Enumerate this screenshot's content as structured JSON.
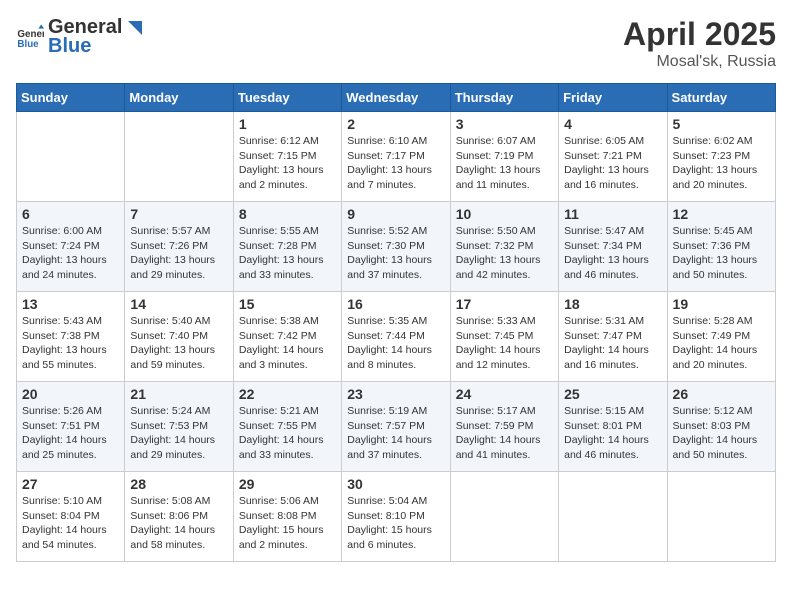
{
  "header": {
    "logo_general": "General",
    "logo_blue": "Blue",
    "month": "April 2025",
    "location": "Mosal'sk, Russia"
  },
  "columns": [
    "Sunday",
    "Monday",
    "Tuesday",
    "Wednesday",
    "Thursday",
    "Friday",
    "Saturday"
  ],
  "weeks": [
    [
      {
        "day": "",
        "info": ""
      },
      {
        "day": "",
        "info": ""
      },
      {
        "day": "1",
        "info": "Sunrise: 6:12 AM\nSunset: 7:15 PM\nDaylight: 13 hours\nand 2 minutes."
      },
      {
        "day": "2",
        "info": "Sunrise: 6:10 AM\nSunset: 7:17 PM\nDaylight: 13 hours\nand 7 minutes."
      },
      {
        "day": "3",
        "info": "Sunrise: 6:07 AM\nSunset: 7:19 PM\nDaylight: 13 hours\nand 11 minutes."
      },
      {
        "day": "4",
        "info": "Sunrise: 6:05 AM\nSunset: 7:21 PM\nDaylight: 13 hours\nand 16 minutes."
      },
      {
        "day": "5",
        "info": "Sunrise: 6:02 AM\nSunset: 7:23 PM\nDaylight: 13 hours\nand 20 minutes."
      }
    ],
    [
      {
        "day": "6",
        "info": "Sunrise: 6:00 AM\nSunset: 7:24 PM\nDaylight: 13 hours\nand 24 minutes."
      },
      {
        "day": "7",
        "info": "Sunrise: 5:57 AM\nSunset: 7:26 PM\nDaylight: 13 hours\nand 29 minutes."
      },
      {
        "day": "8",
        "info": "Sunrise: 5:55 AM\nSunset: 7:28 PM\nDaylight: 13 hours\nand 33 minutes."
      },
      {
        "day": "9",
        "info": "Sunrise: 5:52 AM\nSunset: 7:30 PM\nDaylight: 13 hours\nand 37 minutes."
      },
      {
        "day": "10",
        "info": "Sunrise: 5:50 AM\nSunset: 7:32 PM\nDaylight: 13 hours\nand 42 minutes."
      },
      {
        "day": "11",
        "info": "Sunrise: 5:47 AM\nSunset: 7:34 PM\nDaylight: 13 hours\nand 46 minutes."
      },
      {
        "day": "12",
        "info": "Sunrise: 5:45 AM\nSunset: 7:36 PM\nDaylight: 13 hours\nand 50 minutes."
      }
    ],
    [
      {
        "day": "13",
        "info": "Sunrise: 5:43 AM\nSunset: 7:38 PM\nDaylight: 13 hours\nand 55 minutes."
      },
      {
        "day": "14",
        "info": "Sunrise: 5:40 AM\nSunset: 7:40 PM\nDaylight: 13 hours\nand 59 minutes."
      },
      {
        "day": "15",
        "info": "Sunrise: 5:38 AM\nSunset: 7:42 PM\nDaylight: 14 hours\nand 3 minutes."
      },
      {
        "day": "16",
        "info": "Sunrise: 5:35 AM\nSunset: 7:44 PM\nDaylight: 14 hours\nand 8 minutes."
      },
      {
        "day": "17",
        "info": "Sunrise: 5:33 AM\nSunset: 7:45 PM\nDaylight: 14 hours\nand 12 minutes."
      },
      {
        "day": "18",
        "info": "Sunrise: 5:31 AM\nSunset: 7:47 PM\nDaylight: 14 hours\nand 16 minutes."
      },
      {
        "day": "19",
        "info": "Sunrise: 5:28 AM\nSunset: 7:49 PM\nDaylight: 14 hours\nand 20 minutes."
      }
    ],
    [
      {
        "day": "20",
        "info": "Sunrise: 5:26 AM\nSunset: 7:51 PM\nDaylight: 14 hours\nand 25 minutes."
      },
      {
        "day": "21",
        "info": "Sunrise: 5:24 AM\nSunset: 7:53 PM\nDaylight: 14 hours\nand 29 minutes."
      },
      {
        "day": "22",
        "info": "Sunrise: 5:21 AM\nSunset: 7:55 PM\nDaylight: 14 hours\nand 33 minutes."
      },
      {
        "day": "23",
        "info": "Sunrise: 5:19 AM\nSunset: 7:57 PM\nDaylight: 14 hours\nand 37 minutes."
      },
      {
        "day": "24",
        "info": "Sunrise: 5:17 AM\nSunset: 7:59 PM\nDaylight: 14 hours\nand 41 minutes."
      },
      {
        "day": "25",
        "info": "Sunrise: 5:15 AM\nSunset: 8:01 PM\nDaylight: 14 hours\nand 46 minutes."
      },
      {
        "day": "26",
        "info": "Sunrise: 5:12 AM\nSunset: 8:03 PM\nDaylight: 14 hours\nand 50 minutes."
      }
    ],
    [
      {
        "day": "27",
        "info": "Sunrise: 5:10 AM\nSunset: 8:04 PM\nDaylight: 14 hours\nand 54 minutes."
      },
      {
        "day": "28",
        "info": "Sunrise: 5:08 AM\nSunset: 8:06 PM\nDaylight: 14 hours\nand 58 minutes."
      },
      {
        "day": "29",
        "info": "Sunrise: 5:06 AM\nSunset: 8:08 PM\nDaylight: 15 hours\nand 2 minutes."
      },
      {
        "day": "30",
        "info": "Sunrise: 5:04 AM\nSunset: 8:10 PM\nDaylight: 15 hours\nand 6 minutes."
      },
      {
        "day": "",
        "info": ""
      },
      {
        "day": "",
        "info": ""
      },
      {
        "day": "",
        "info": ""
      }
    ]
  ]
}
